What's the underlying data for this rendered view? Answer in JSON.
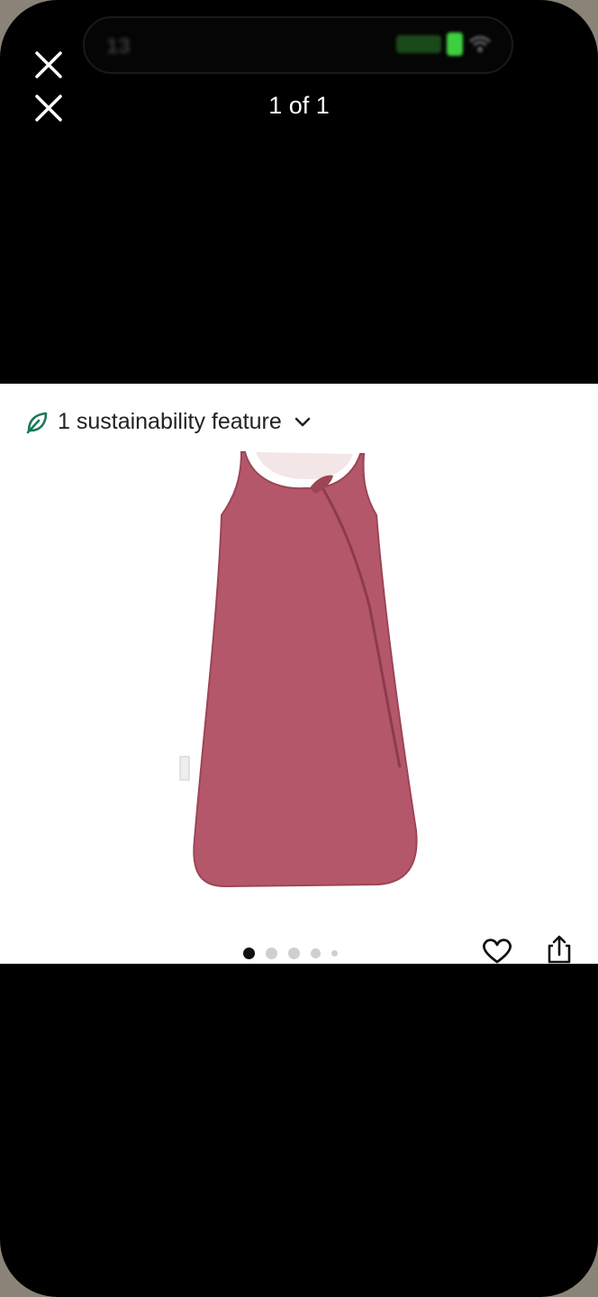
{
  "status_bar": {
    "time": "13"
  },
  "header": {
    "counter": "1 of 1"
  },
  "product": {
    "sustainability_label": "1 sustainability feature",
    "sustainability_icon": "leaf-icon",
    "image_description": "pink sleeveless baby sleep sack"
  },
  "carousel": {
    "dot_count": 5,
    "active_index": 0
  },
  "colors": {
    "accent_leaf": "#1a7a5a",
    "garment": "#b5576a"
  }
}
